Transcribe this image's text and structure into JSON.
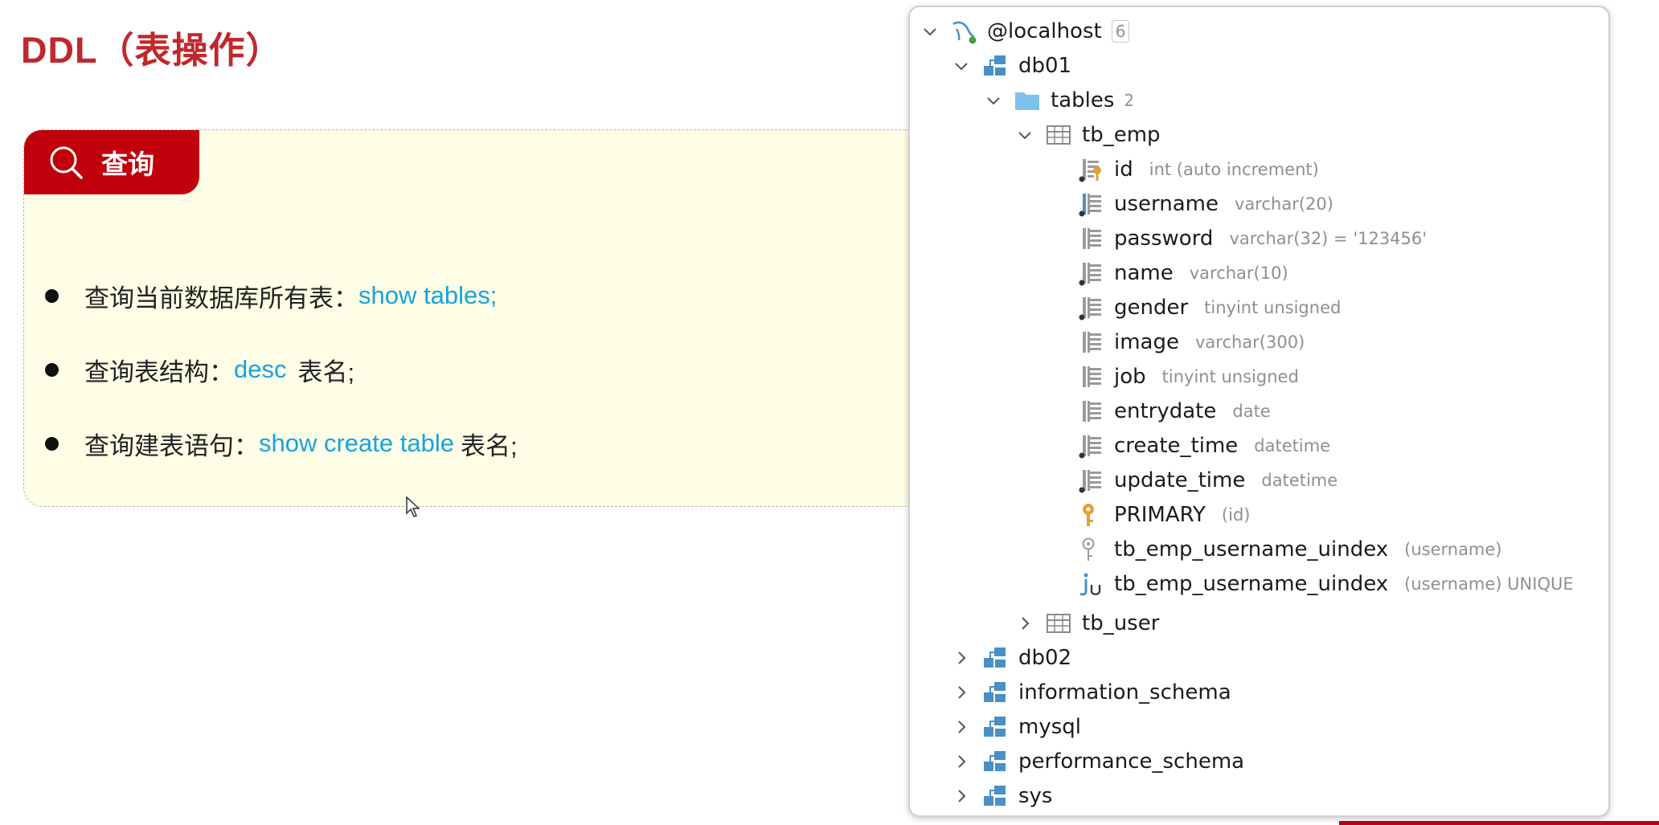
{
  "slide": {
    "title": "DDL（表操作）",
    "card": {
      "tab_label": "查询",
      "items": [
        {
          "text": "查询当前数据库所有表：",
          "cmd": "show tables;",
          "suffix": ""
        },
        {
          "text": "查询表结构：",
          "cmd": "desc",
          "suffix": "表名;"
        },
        {
          "text": "查询建表语句：",
          "cmd": "show create table",
          "suffix": "表名;"
        }
      ]
    }
  },
  "tree": {
    "host": {
      "label": "@localhost",
      "badge": "6"
    },
    "db01": {
      "label": "db01"
    },
    "tables": {
      "label": "tables",
      "count": "2"
    },
    "tb_emp": {
      "label": "tb_emp"
    },
    "columns": [
      {
        "name": "id",
        "type": "int (auto increment)",
        "icon": "primary-key-column-icon"
      },
      {
        "name": "username",
        "type": "varchar(20)",
        "icon": "column-icon"
      },
      {
        "name": "password",
        "type": "varchar(32) = '123456'",
        "icon": "column-icon"
      },
      {
        "name": "name",
        "type": "varchar(10)",
        "icon": "column-icon"
      },
      {
        "name": "gender",
        "type": "tinyint unsigned",
        "icon": "column-icon"
      },
      {
        "name": "image",
        "type": "varchar(300)",
        "icon": "column-icon"
      },
      {
        "name": "job",
        "type": "tinyint unsigned",
        "icon": "column-icon"
      },
      {
        "name": "entrydate",
        "type": "date",
        "icon": "column-icon"
      },
      {
        "name": "create_time",
        "type": "datetime",
        "icon": "column-icon"
      },
      {
        "name": "update_time",
        "type": "datetime",
        "icon": "column-icon"
      }
    ],
    "keys": [
      {
        "name": "PRIMARY",
        "detail": "(id)",
        "icon": "primary-key-icon"
      },
      {
        "name": "tb_emp_username_uindex",
        "detail": "(username)",
        "icon": "key-icon"
      },
      {
        "name": "tb_emp_username_uindex",
        "detail": "(username) UNIQUE",
        "icon": "unique-index-icon"
      }
    ],
    "tb_user": {
      "label": "tb_user"
    },
    "schemas": [
      {
        "label": "db02"
      },
      {
        "label": "information_schema"
      },
      {
        "label": "mysql"
      },
      {
        "label": "performance_schema"
      },
      {
        "label": "sys"
      }
    ]
  },
  "colors": {
    "title_red": "#c0282d",
    "tab_red": "#c0000b",
    "card_bg": "#fefde6",
    "command_blue": "#17a3df",
    "type_gray": "#8f8f8f",
    "key_gold": "#e1a437"
  }
}
